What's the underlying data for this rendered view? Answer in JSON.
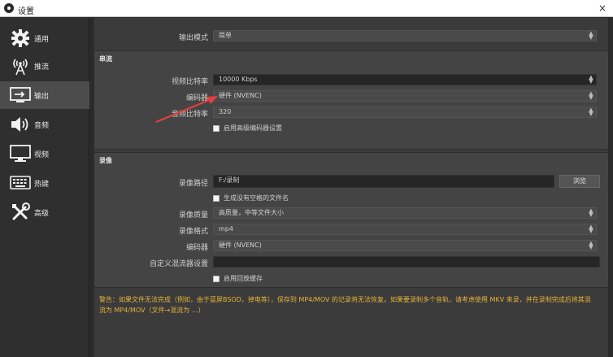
{
  "window": {
    "title": "设置",
    "close_glyph": "×"
  },
  "sidebar": {
    "items": [
      {
        "label": "通用",
        "icon": "gear-icon"
      },
      {
        "label": "推流",
        "icon": "antenna-icon"
      },
      {
        "label": "输出",
        "icon": "output-icon",
        "active": true
      },
      {
        "label": "音频",
        "icon": "speaker-icon"
      },
      {
        "label": "视频",
        "icon": "monitor-icon"
      },
      {
        "label": "热键",
        "icon": "keyboard-icon"
      },
      {
        "label": "高级",
        "icon": "tools-icon"
      }
    ]
  },
  "output_mode": {
    "label": "输出模式",
    "value": "简单"
  },
  "streaming": {
    "title": "串流",
    "video_bitrate": {
      "label": "视频比特率",
      "value": "10000 Kbps"
    },
    "encoder": {
      "label": "编码器",
      "value": "硬件 (NVENC)"
    },
    "audio_bitrate": {
      "label": "音频比特率",
      "value": "320"
    },
    "advanced_checkbox": "启用高级编码器设置"
  },
  "recording": {
    "title": "录像",
    "path": {
      "label": "录像路径",
      "value": "F:/录制"
    },
    "browse_label": "浏览",
    "no_space_checkbox": "生成没有空格的文件名",
    "quality": {
      "label": "录像质量",
      "value": "高质量，中等文件大小"
    },
    "format": {
      "label": "录像格式",
      "value": "mp4"
    },
    "encoder": {
      "label": "编码器",
      "value": "硬件 (NVENC)"
    },
    "muxer": {
      "label": "自定义混流器设置",
      "value": ""
    },
    "replay_checkbox": "启用回放缓存"
  },
  "warning_text": "警告：如果文件无法完成（例如，由于蓝屏BSOD，掉电等），保存到 MP4/MOV 的记录将无法恢复。如果要录制多个音轨，请考虑使用 MKV 来录，并在录制完成后将其混流为 MP4/MOV（文件→混流为 ...）",
  "colors": {
    "accent_warning": "#e6b33a",
    "arrow": "#e04040"
  }
}
